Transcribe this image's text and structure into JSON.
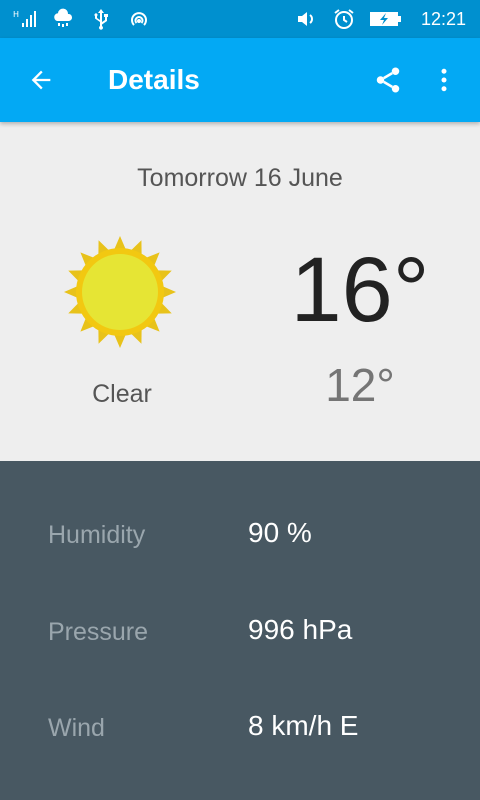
{
  "status_bar": {
    "time": "12:21",
    "icons": [
      "signal-icon",
      "weather-notification-icon",
      "usb-icon",
      "hotspot-icon",
      "volume-icon",
      "alarm-icon",
      "battery-charging-icon"
    ]
  },
  "app_bar": {
    "title": "Details",
    "back_icon": "arrow-back-icon",
    "share_icon": "share-icon",
    "menu_icon": "more-vert-icon",
    "color": "#03a9f4"
  },
  "forecast": {
    "date": "Tomorrow 16 June",
    "condition": "Clear",
    "icon": "sun-icon",
    "high": "16°",
    "low": "12°"
  },
  "details": [
    {
      "label": "Humidity",
      "value": "90 %"
    },
    {
      "label": "Pressure",
      "value": "996 hPa"
    },
    {
      "label": "Wind",
      "value": "8 km/h E"
    }
  ]
}
